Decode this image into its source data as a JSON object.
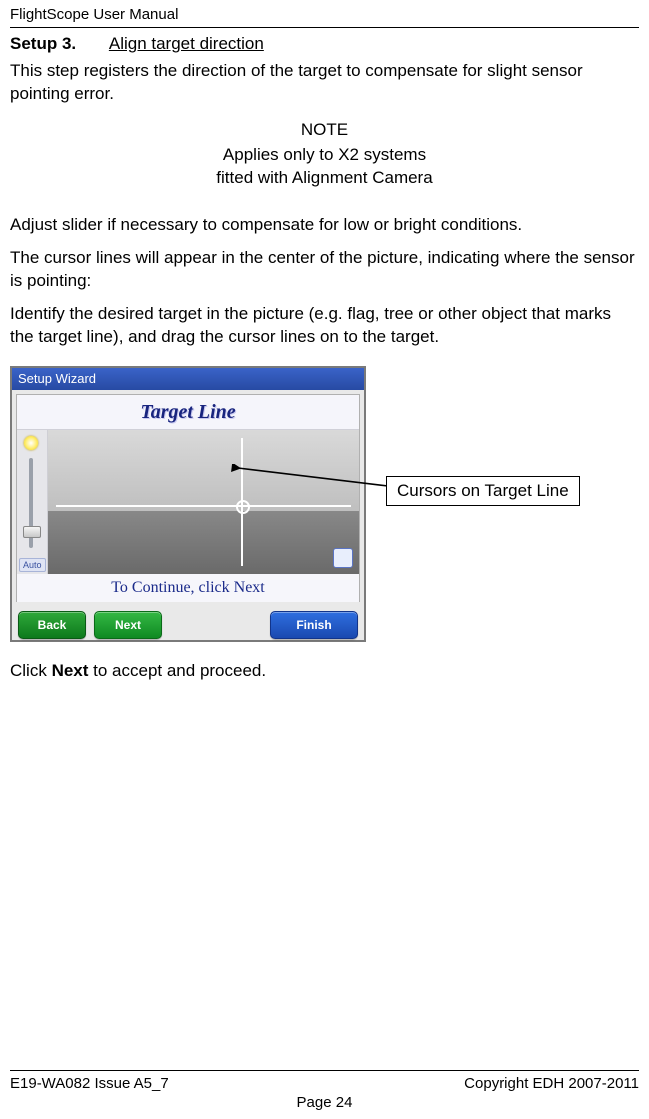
{
  "header": {
    "title": "FlightScope User Manual"
  },
  "setup": {
    "label": "Setup 3.",
    "title": "Align target direction"
  },
  "paragraphs": {
    "intro": "This step registers the direction of the target to compensate for slight sensor pointing error.",
    "note_head": "NOTE",
    "note_line1": "Applies only to X2 systems",
    "note_line2": "fitted with Alignment Camera",
    "adjust": "Adjust slider if necessary to compensate for low or bright conditions.",
    "cursor": "The cursor lines will appear in the center of the picture, indicating where the sensor is pointing:",
    "identify_pre": "Identify the desired target in the picture ",
    "identify_mid": "(e.g. flag, tree or other object that marks the target line)",
    "identify_post": ", and drag the cursor lines on to the target.",
    "click_pre": "Click ",
    "click_bold": "Next",
    "click_post": " to accept and proceed."
  },
  "wizard": {
    "window_title": "Setup Wizard",
    "heading": "Target Line",
    "auto_label": "Auto",
    "continue_text": "To Continue, click Next",
    "buttons": {
      "back": "Back",
      "next": "Next",
      "finish": "Finish"
    }
  },
  "callout": {
    "text": "Cursors on Target Line"
  },
  "footer": {
    "left": "E19-WA082 Issue A5_7",
    "right": "Copyright EDH 2007-2011",
    "center": "Page 24"
  }
}
